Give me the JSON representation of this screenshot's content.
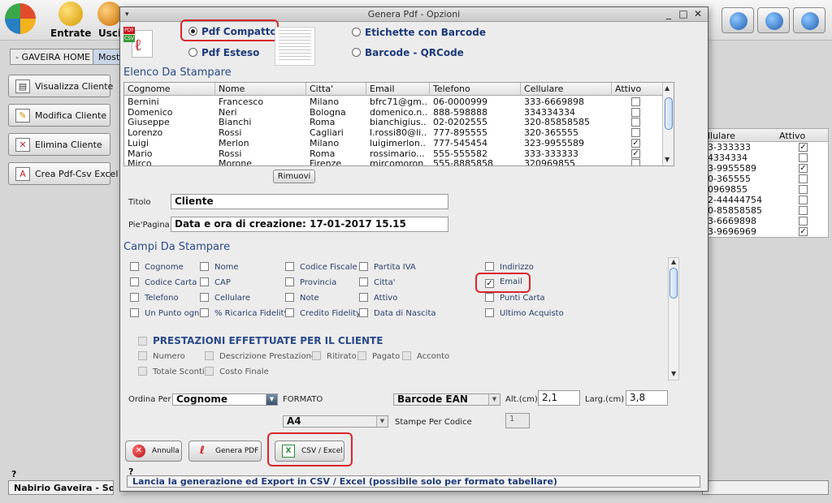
{
  "app": {
    "toolbar": {
      "entrate_label": "Entrate",
      "uscite_label": "Usci"
    },
    "tabs": [
      "- GAVEIRA HOME -",
      "Mostr"
    ],
    "side_buttons": [
      "Visualizza Cliente",
      "Modifica Cliente",
      "Elimina Cliente",
      "Crea Pdf-Csv Excel"
    ],
    "bg_table": {
      "col_cellulare": "llulare",
      "col_attivo": "Attivo",
      "rows": [
        {
          "cell": "3-333333",
          "checked": true
        },
        {
          "cell": "4334334",
          "checked": false
        },
        {
          "cell": "3-9955589",
          "checked": true
        },
        {
          "cell": "0-365555",
          "checked": false
        },
        {
          "cell": "0969855",
          "checked": false
        },
        {
          "cell": "2-44444754",
          "checked": false
        },
        {
          "cell": "0-85858585",
          "checked": false
        },
        {
          "cell": "3-6669898",
          "checked": false
        },
        {
          "cell": "3-9696969",
          "checked": true
        }
      ]
    },
    "status_q": "?",
    "status_user": "Nabirio Gaveira - Softv"
  },
  "dialog": {
    "title": "Genera Pdf - Opzioni",
    "menu_glyph": "▾",
    "minimize_glyph": "_",
    "maximize_glyph": "□",
    "close_glyph": "✕",
    "icon_pdf": "PDF",
    "icon_csv": "CSV",
    "formats": {
      "pdf_compatto": "Pdf Compatto",
      "pdf_esteso": "Pdf Esteso",
      "etichette_barcode": "Etichette con Barcode",
      "barcode_qrcode": "Barcode - QRCode"
    },
    "elenco_title": "Elenco Da Stampare",
    "table": {
      "columns": [
        "Cognome",
        "Nome",
        "Citta'",
        "Email",
        "Telefono",
        "Cellulare",
        "Attivo"
      ],
      "rows": [
        {
          "cognome": "Bernini",
          "nome": "Francesco",
          "citta": "Milano",
          "email": "bfrc71@gm...",
          "telefono": "06-0000999",
          "cellulare": "333-6669898",
          "attivo": false
        },
        {
          "cognome": "Domenico",
          "nome": "Neri",
          "citta": "Bologna",
          "email": "domenico.n...",
          "telefono": "888-598888",
          "cellulare": "334334334",
          "attivo": false
        },
        {
          "cognome": "Giuseppe",
          "nome": "Bianchi",
          "citta": "Roma",
          "email": "bianchigius...",
          "telefono": "02-0202555",
          "cellulare": "320-85858585",
          "attivo": false
        },
        {
          "cognome": "Lorenzo",
          "nome": "Rossi",
          "citta": "Cagliari",
          "email": "l.rossi80@li...",
          "telefono": "777-895555",
          "cellulare": "320-365555",
          "attivo": false
        },
        {
          "cognome": "Luigi",
          "nome": "Merlon",
          "citta": "Milano",
          "email": "luigimerlon...",
          "telefono": "777-545454",
          "cellulare": "323-9955589",
          "attivo": true
        },
        {
          "cognome": "Mario",
          "nome": "Rossi",
          "citta": "Roma",
          "email": "rossimario...",
          "telefono": "555-555582",
          "cellulare": "333-333333",
          "attivo": true
        },
        {
          "cognome": "Mirco",
          "nome": "Morone",
          "citta": "Firenze",
          "email": "mircomoron...",
          "telefono": "555-8885858",
          "cellulare": "320969855",
          "attivo": false
        }
      ]
    },
    "rimuovi_label": "Rimuovi",
    "titolo_label": "Titolo",
    "titolo_value": "Cliente",
    "piepagina_label": "Pie'Pagina",
    "piepagina_value": "Data e ora di creazione: 17-01-2017 15.15",
    "campi_title": "Campi Da Stampare",
    "campi": {
      "cognome": "Cognome",
      "nome": "Nome",
      "codice_fiscale": "Codice Fiscale",
      "partita_iva": "Partita IVA",
      "indirizzo": "Indirizzo",
      "codice_carta": "Codice Carta",
      "cap": "CAP",
      "provincia": "Provincia",
      "citta": "Citta'",
      "email": "Email",
      "telefono": "Telefono",
      "cellulare": "Cellulare",
      "note": "Note",
      "attivo": "Attivo",
      "punti_carta": "Punti Carta",
      "un_punto_ogni": "Un Punto ogni",
      "ricarica_fidelity": "% Ricarica Fidelity",
      "credito_fidelity": "Credito Fidelity",
      "data_nascita": "Data di Nascita",
      "ultimo_acquisto": "Ultimo Acquisto"
    },
    "prestazioni": {
      "title": "PRESTAZIONI EFFETTUATE PER IL CLIENTE",
      "numero": "Numero",
      "descrizione": "Descrizione Prestazione",
      "ritirato": "Ritirato",
      "pagato": "Pagato",
      "acconto": "Acconto",
      "totale_sconti": "Totale Sconti",
      "costo_finale": "Costo Finale"
    },
    "ordina_label": "Ordina Per",
    "ordina_value": "Cognome",
    "formato_label": "FORMATO",
    "barcode_value": "Barcode EAN",
    "alt_label": "Alt.(cm)",
    "alt_value": "2,1",
    "larg_label": "Larg.(cm)",
    "larg_value": "3,8",
    "paper_value": "A4",
    "stampe_label": "Stampe Per Codice",
    "stampe_value": "1",
    "annulla_label": "Annulla",
    "genera_pdf_label": "Genera PDF",
    "csv_excel_label": "CSV / Excel",
    "status_q": "?",
    "status_text": "Lancia la generazione ed Export in CSV / Excel (possibile solo per formato tabellare)",
    "accent_red": "#d9262b",
    "accent_blue": "#2a4a8a"
  }
}
